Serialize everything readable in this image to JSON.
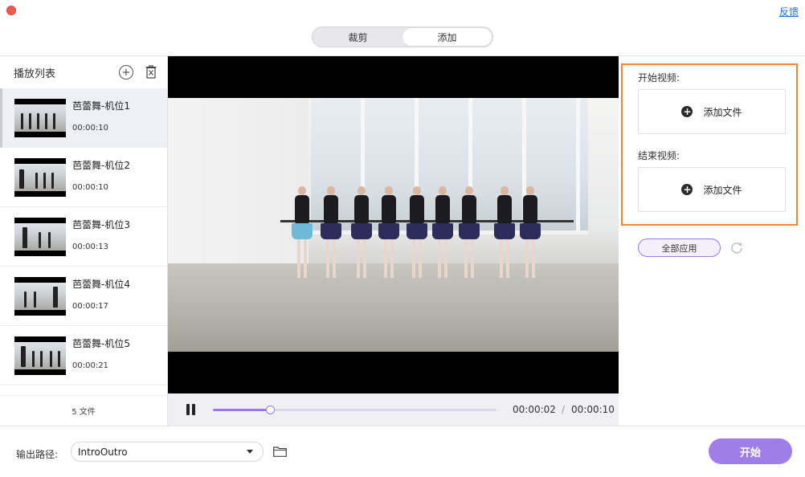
{
  "window": {
    "feedback_label": "反馈"
  },
  "tabs": [
    {
      "label": "裁剪",
      "active": false
    },
    {
      "label": "添加",
      "active": true
    }
  ],
  "playlist": {
    "title": "播放列表",
    "items": [
      {
        "name": "芭蕾舞-机位1",
        "duration": "00:00:10"
      },
      {
        "name": "芭蕾舞-机位2",
        "duration": "00:00:10"
      },
      {
        "name": "芭蕾舞-机位3",
        "duration": "00:00:13"
      },
      {
        "name": "芭蕾舞-机位4",
        "duration": "00:00:17"
      },
      {
        "name": "芭蕾舞-机位5",
        "duration": "00:00:21"
      }
    ],
    "file_count": "5 文件"
  },
  "player": {
    "current_time": "00:00:02",
    "separator": "/",
    "total_time": "00:00:10",
    "progress_fraction": 0.2
  },
  "right_panel": {
    "start_video_label": "开始视频:",
    "start_add_label": "添加文件",
    "end_video_label": "结束视频:",
    "end_add_label": "添加文件",
    "apply_all_label": "全部应用"
  },
  "bottom": {
    "output_label": "输出路径:",
    "output_value": "IntroOutro",
    "start_label": "开始"
  },
  "colors": {
    "accent": "#9a78e8",
    "highlight": "#f5842a",
    "close": "#ee5a52",
    "link": "#1f6fe0"
  }
}
